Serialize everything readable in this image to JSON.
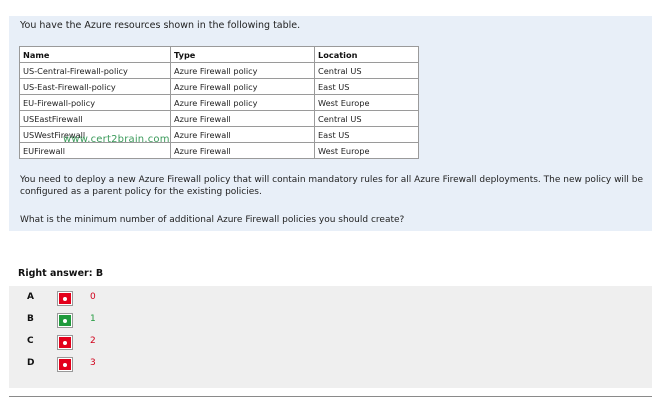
{
  "question": {
    "intro": "You have the Azure resources shown in the following table.",
    "table": {
      "headers": [
        "Name",
        "Type",
        "Location"
      ],
      "rows": [
        [
          "US-Central-Firewall-policy",
          "Azure Firewall policy",
          "Central US"
        ],
        [
          "US-East-Firewall-policy",
          "Azure Firewall policy",
          "East US"
        ],
        [
          "EU-Firewall-policy",
          "Azure Firewall policy",
          "West Europe"
        ],
        [
          "USEastFirewall",
          "Azure Firewall",
          "Central US"
        ],
        [
          "USWestFirewall",
          "Azure Firewall",
          "East US"
        ],
        [
          "EUFirewall",
          "Azure Firewall",
          "West Europe"
        ]
      ]
    },
    "watermark": "www.cert2brain.com",
    "paragraph1": "You need to deploy a new Azure Firewall policy that will contain mandatory rules for all Azure Firewall deployments. The new policy will be configured as a parent policy for the existing policies.",
    "paragraph2": "What is the minimum number of additional Azure Firewall policies you should create?"
  },
  "answer": {
    "label": "Right answer: B"
  },
  "options": [
    {
      "letter": "A",
      "value": "0",
      "correct": false
    },
    {
      "letter": "B",
      "value": "1",
      "correct": true
    },
    {
      "letter": "C",
      "value": "2",
      "correct": false
    },
    {
      "letter": "D",
      "value": "3",
      "correct": false
    }
  ],
  "colors": {
    "panel_bg": "#e8eff8",
    "options_bg": "#efefef",
    "correct": "#1f9a3c",
    "wrong": "#e3001b"
  }
}
